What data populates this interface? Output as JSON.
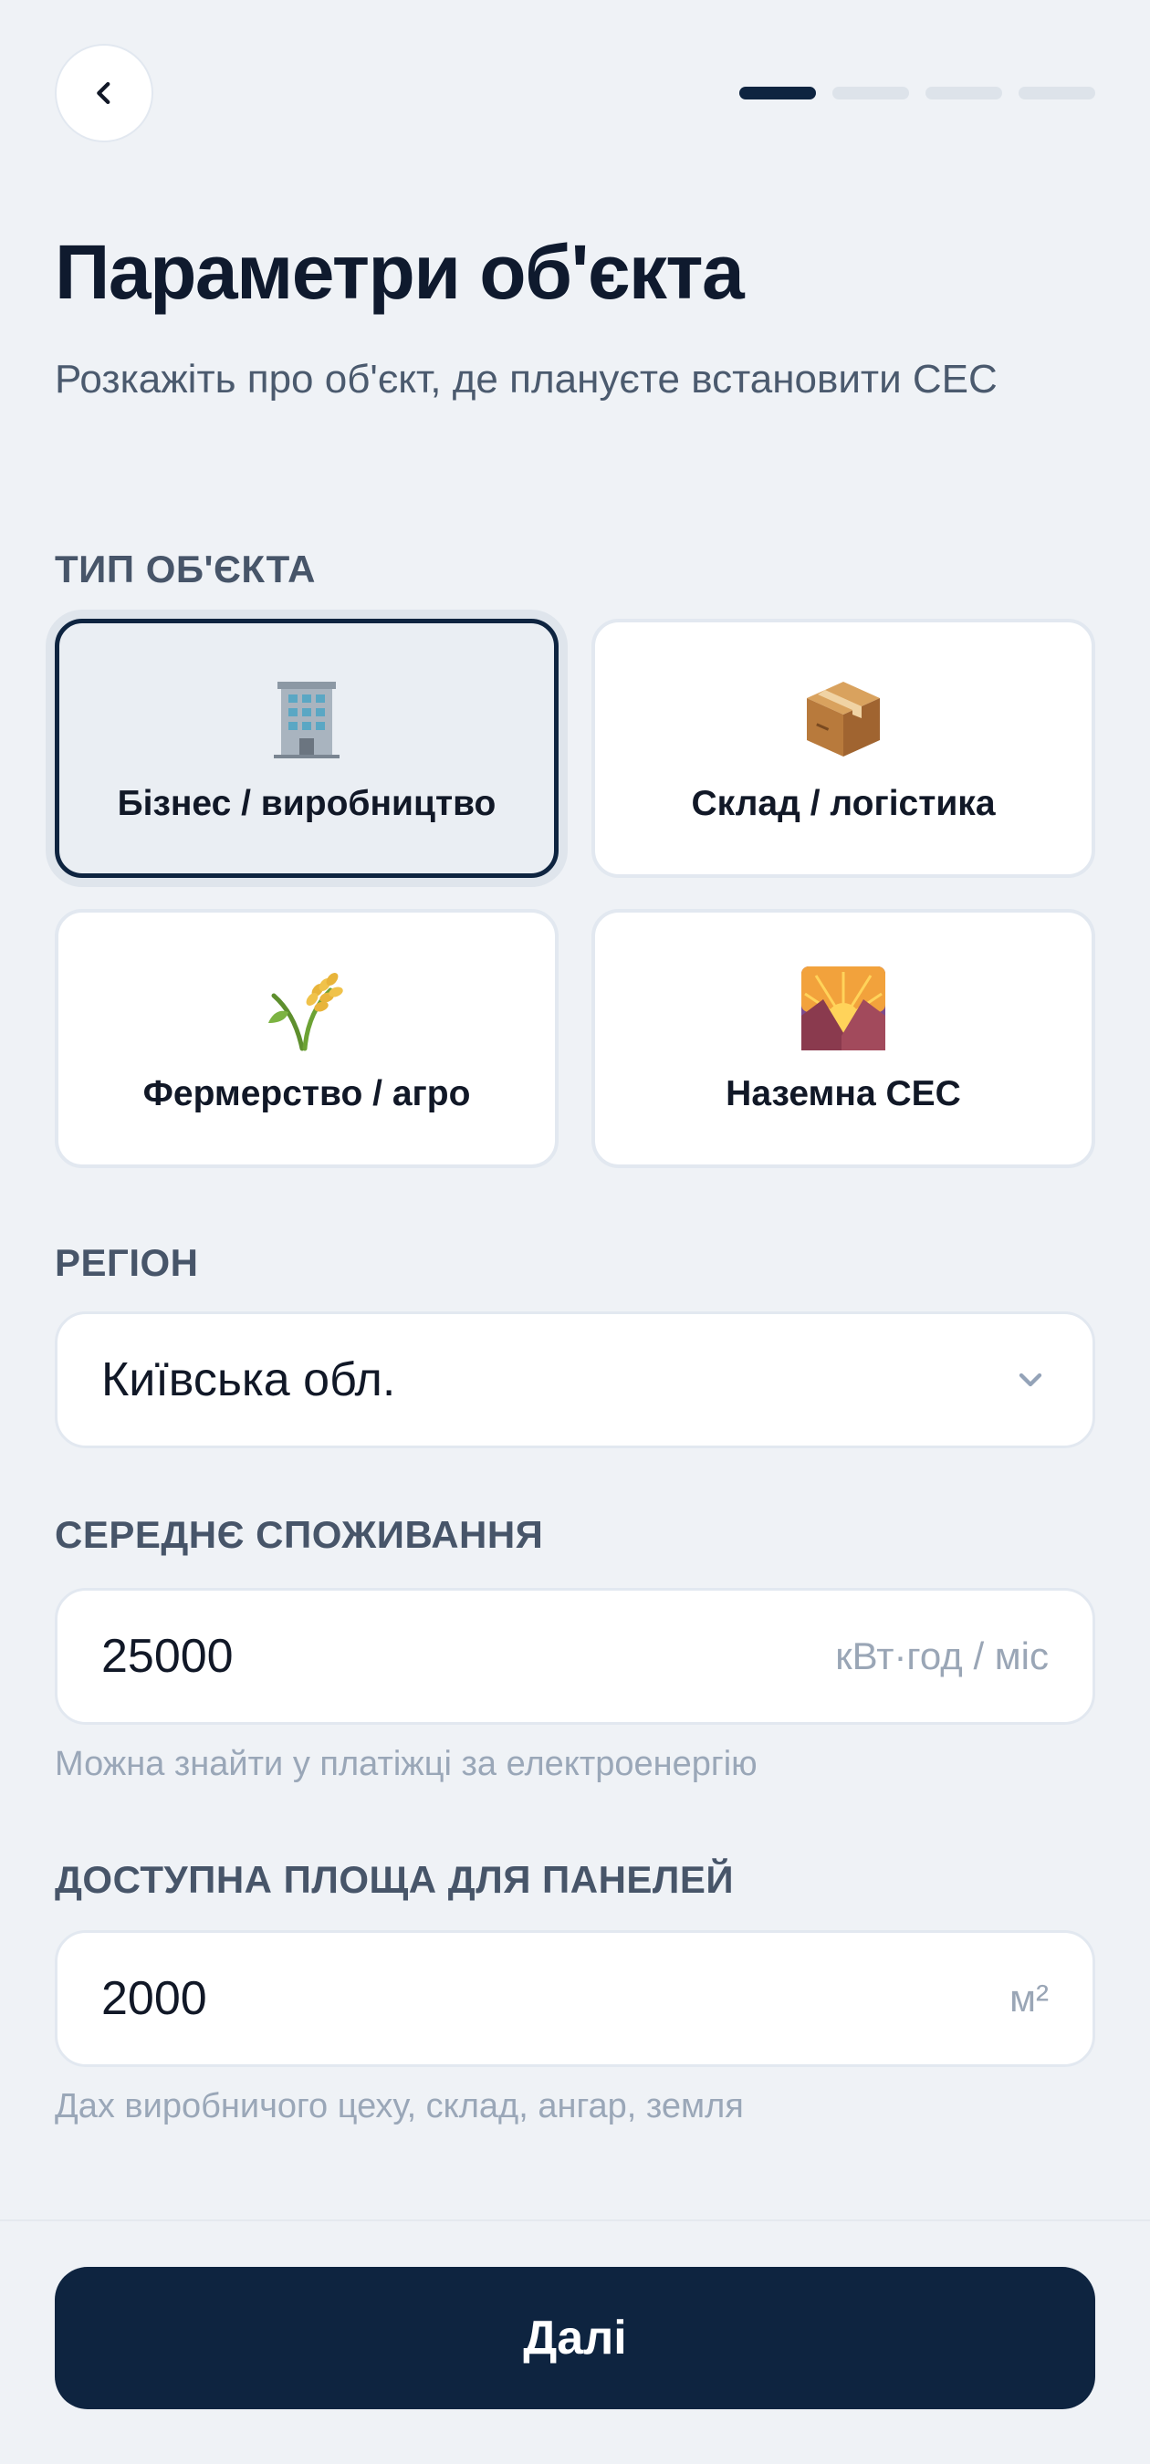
{
  "header": {
    "back_icon": "chevron-left-icon",
    "progress_steps": 4,
    "progress_active": 1
  },
  "title": "Параметри об'єкта",
  "subtitle": "Розкажіть про об'єкт, де плануєте встановити СЕС",
  "object_type": {
    "label": "ТИП ОБ'ЄКТА",
    "options": [
      {
        "label": "Бізнес / виробництво",
        "icon": "office-building-icon",
        "selected": true
      },
      {
        "label": "Склад / логістика",
        "icon": "package-box-icon",
        "selected": false
      },
      {
        "label": "Фермерство / агро",
        "icon": "rice-sheaf-icon",
        "selected": false
      },
      {
        "label": "Наземна СЕС",
        "icon": "sunrise-over-mountains-icon",
        "selected": false
      }
    ]
  },
  "region": {
    "label": "РЕГІОН",
    "value": "Київська обл.",
    "icon": "chevron-down-icon"
  },
  "consumption": {
    "label": "СЕРЕДНЄ СПОЖИВАННЯ",
    "value": "25000",
    "unit": "кВт·год / міс",
    "hint": "Можна знайти у платіжці за електроенергію"
  },
  "area": {
    "label": "ДОСТУПНА ПЛОЩА ДЛЯ ПАНЕЛЕЙ",
    "value": "2000",
    "unit": "м²",
    "hint": "Дах виробничого цеху, склад, ангар, земля"
  },
  "next_button": "Далі",
  "colors": {
    "primary": "#0e2440",
    "background": "#eff2f6",
    "muted_text": "#9aa7b8"
  }
}
